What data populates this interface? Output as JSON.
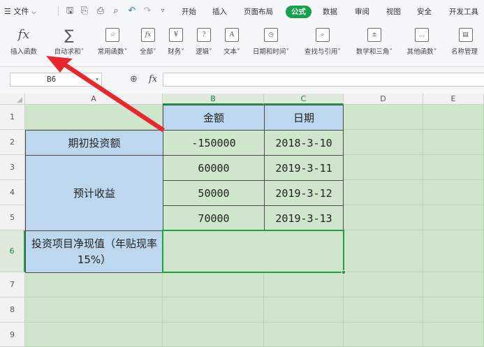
{
  "menubar": {
    "file_label": "文件",
    "tabs": [
      {
        "label": "开始"
      },
      {
        "label": "插入"
      },
      {
        "label": "页面布局"
      },
      {
        "label": "公式",
        "active": true
      },
      {
        "label": "数据"
      },
      {
        "label": "审阅"
      },
      {
        "label": "视图"
      },
      {
        "label": "安全"
      },
      {
        "label": "开发工具"
      }
    ]
  },
  "ribbon": {
    "buttons": [
      {
        "label": "插入函数",
        "icon": "fx-icon"
      },
      {
        "label": "自动求和",
        "icon": "sigma-icon",
        "dropdown": true
      },
      {
        "label": "常用函数",
        "icon": "star-fx-icon",
        "dropdown": true
      },
      {
        "label": "全部",
        "icon": "fx-box-icon",
        "dropdown": true
      },
      {
        "label": "财务",
        "icon": "yen-book-icon",
        "dropdown": true
      },
      {
        "label": "逻辑",
        "icon": "question-book-icon",
        "dropdown": true
      },
      {
        "label": "文本",
        "icon": "a-book-icon",
        "dropdown": true
      },
      {
        "label": "日期和时间",
        "icon": "clock-book-icon",
        "dropdown": true
      },
      {
        "label": "查找与引用",
        "icon": "magnifier-book-icon",
        "dropdown": true
      },
      {
        "label": "数学和三角",
        "icon": "math-book-icon",
        "dropdown": true
      },
      {
        "label": "其他函数",
        "icon": "more-book-icon",
        "dropdown": true
      },
      {
        "label": "名称管理",
        "icon": "name-manager-icon"
      }
    ]
  },
  "formula_bar": {
    "cell_ref": "B6",
    "fx_label": "fx",
    "formula": ""
  },
  "sheet": {
    "columns": [
      "A",
      "B",
      "C",
      "D",
      "E"
    ],
    "rows": [
      "1",
      "2",
      "3",
      "4",
      "5",
      "6",
      "7",
      "8",
      "9"
    ],
    "selected_cell": "B6",
    "cells": {
      "b1": "金额",
      "c1": "日期",
      "a2": "期初投资额",
      "b2": "-150000",
      "c2": "2018-3-10",
      "a3_5": "预计收益",
      "b3": "60000",
      "c3": "2019-3-11",
      "b4": "50000",
      "c4": "2019-3-12",
      "b5": "70000",
      "c5": "2019-3-13",
      "a6": "投资项目净现值（年贴现率15%）",
      "b6": ""
    }
  },
  "colors": {
    "active_tab": "#16a24a",
    "header_fill": "#bdd7ee",
    "sheet_background": "#cfe6cc",
    "selection_border": "#1e9e49",
    "annotation_arrow": "#e8262b"
  }
}
